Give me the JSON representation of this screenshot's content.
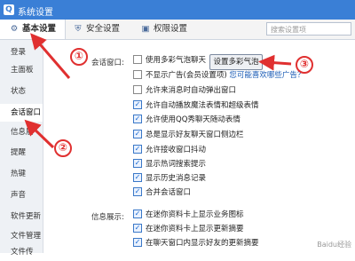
{
  "window": {
    "title": "系统设置"
  },
  "nav": {
    "tabs": [
      {
        "label": "基本设置",
        "icon": "gear-icon",
        "active": true
      },
      {
        "label": "安全设置",
        "icon": "shield-icon",
        "active": false
      },
      {
        "label": "权限设置",
        "icon": "lock-icon",
        "active": false
      }
    ],
    "search_placeholder": "搜索设置项"
  },
  "sidebar": {
    "items": [
      {
        "label": "登录"
      },
      {
        "label": "主面板"
      },
      {
        "label": "状态"
      },
      {
        "label": "会话窗口",
        "active": true
      },
      {
        "label": "信息展"
      },
      {
        "label": "提醒"
      },
      {
        "label": "热键"
      },
      {
        "label": "声音"
      },
      {
        "label": "软件更新"
      },
      {
        "label": "文件管理"
      },
      {
        "label": "文件传"
      }
    ]
  },
  "session": {
    "section_label": "会话窗口:",
    "options": [
      {
        "label": "使用多彩气泡聊天",
        "checked": false
      },
      {
        "label": "不显示广告(会员设置项)",
        "checked": false,
        "link": "您可能喜欢哪些广告？"
      },
      {
        "label": "允许来消息时自动弹出窗口",
        "checked": false
      },
      {
        "label": "允许自动播放魔法表情和超级表情",
        "checked": true
      },
      {
        "label": "允许使用QQ秀聊天随动表情",
        "checked": true
      },
      {
        "label": "总是显示好友聊天窗口侧边栏",
        "checked": true
      },
      {
        "label": "允许接收窗口抖动",
        "checked": true
      },
      {
        "label": "显示热词搜索提示",
        "checked": true
      },
      {
        "label": "显示历史消息记录",
        "checked": true
      },
      {
        "label": "合并会话窗口",
        "checked": true
      }
    ],
    "bubble_button": "设置多彩气泡"
  },
  "info": {
    "section_label": "信息展示:",
    "options": [
      {
        "label": "在迷你资料卡上显示业务图标",
        "checked": true
      },
      {
        "label": "在迷你资料卡上显示更新摘要",
        "checked": true
      },
      {
        "label": "在聊天窗口内显示好友的更新摘要",
        "checked": true
      }
    ]
  },
  "annotations": {
    "n1": "①",
    "n2": "②",
    "n3": "③"
  },
  "watermark": "Baidu经验",
  "colors": {
    "accent": "#3a7fd6",
    "annotation": "#e03030"
  }
}
